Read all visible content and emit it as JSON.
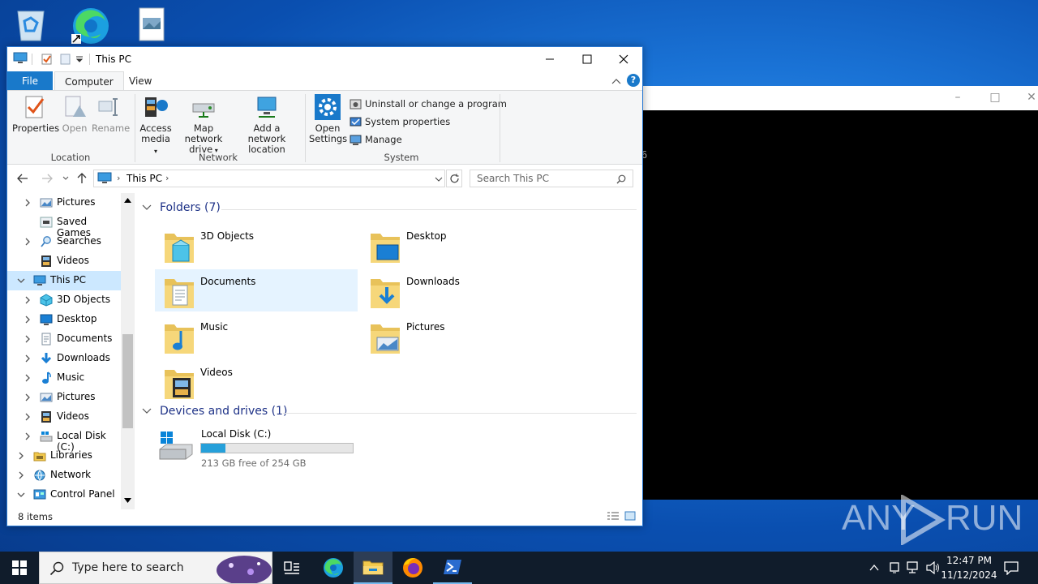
{
  "window": {
    "title": "This PC",
    "controls": {
      "minimize": "minimize",
      "maximize": "maximize",
      "close": "close"
    }
  },
  "ribbon": {
    "tabs": [
      {
        "label": "File"
      },
      {
        "label": "Computer"
      },
      {
        "label": "View"
      }
    ],
    "help": "?",
    "groups": {
      "location": {
        "label": "Location",
        "buttons": [
          {
            "label": "Properties"
          },
          {
            "label": "Open"
          },
          {
            "label": "Rename"
          }
        ]
      },
      "network": {
        "label": "Network",
        "buttons": [
          {
            "label": "Access\nmedia"
          },
          {
            "label": "Map network\ndrive"
          },
          {
            "label": "Add a network\nlocation"
          }
        ]
      },
      "system": {
        "label": "System",
        "open_settings": "Open\nSettings",
        "items": [
          {
            "label": "Uninstall or change a program"
          },
          {
            "label": "System properties"
          },
          {
            "label": "Manage"
          }
        ]
      }
    }
  },
  "address": {
    "crumb": "This PC",
    "search_placeholder": "Search This PC"
  },
  "tree": [
    {
      "label": "Pictures",
      "icon": "pictures-icon"
    },
    {
      "label": "Saved Games",
      "icon": "saved-games-icon"
    },
    {
      "label": "Searches",
      "icon": "search-icon"
    },
    {
      "label": "Videos",
      "icon": "videos-icon"
    },
    {
      "label": "This PC",
      "icon": "computer-icon"
    },
    {
      "label": "3D Objects",
      "icon": "3d-objects-icon"
    },
    {
      "label": "Desktop",
      "icon": "desktop-icon"
    },
    {
      "label": "Documents",
      "icon": "documents-icon"
    },
    {
      "label": "Downloads",
      "icon": "downloads-icon"
    },
    {
      "label": "Music",
      "icon": "music-icon"
    },
    {
      "label": "Pictures",
      "icon": "pictures-icon"
    },
    {
      "label": "Videos",
      "icon": "videos-icon"
    },
    {
      "label": "Local Disk (C:)",
      "icon": "drive-icon"
    },
    {
      "label": "Libraries",
      "icon": "libraries-icon"
    },
    {
      "label": "Network",
      "icon": "network-icon"
    },
    {
      "label": "Control Panel",
      "icon": "control-panel-icon"
    }
  ],
  "content": {
    "folders_header": "Folders (7)",
    "folders": [
      {
        "name": "3D Objects"
      },
      {
        "name": "Desktop"
      },
      {
        "name": "Documents"
      },
      {
        "name": "Downloads"
      },
      {
        "name": "Music"
      },
      {
        "name": "Pictures"
      },
      {
        "name": "Videos"
      }
    ],
    "drives_header": "Devices and drives (1)",
    "drive": {
      "name": "Local Disk (C:)",
      "free_text": "213 GB free of 254 GB",
      "used_fraction": 0.16
    }
  },
  "status": {
    "items": "8 items"
  },
  "taskbar": {
    "search_placeholder": "Type here to search",
    "time": "12:47 PM",
    "date": "11/12/2024"
  },
  "watermark": {
    "text_left": "ANY",
    "text_right": "RUN"
  },
  "colors": {
    "accent": "#1979ca",
    "selection": "#cce8ff",
    "drive_bar": "#26a0da"
  }
}
